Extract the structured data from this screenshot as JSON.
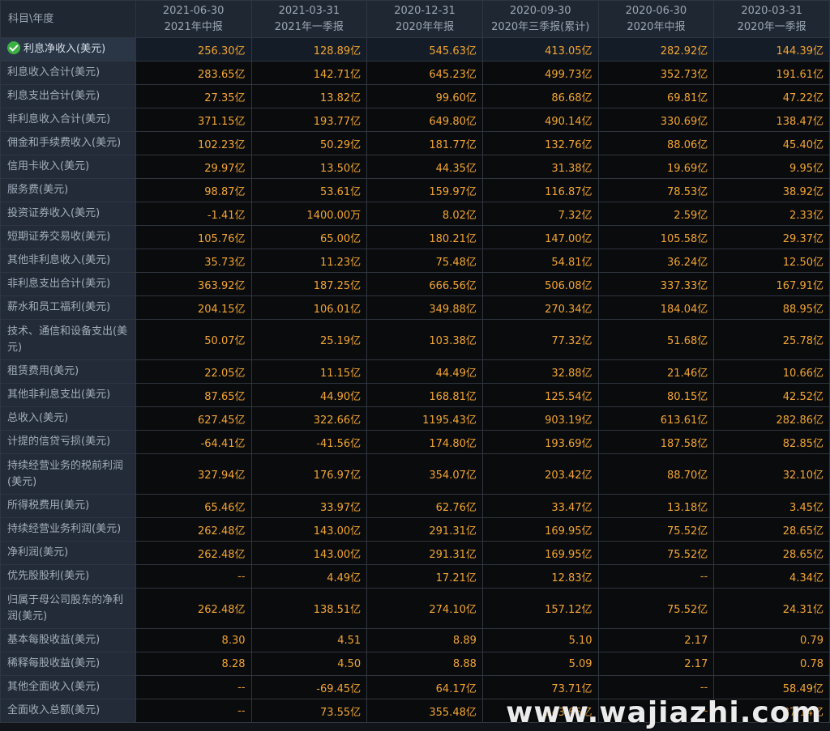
{
  "header": {
    "corner": "科目\\年度",
    "periods": [
      {
        "date": "2021-06-30",
        "label": "2021年中报"
      },
      {
        "date": "2021-03-31",
        "label": "2021年一季报"
      },
      {
        "date": "2020-12-31",
        "label": "2020年年报"
      },
      {
        "date": "2020-09-30",
        "label": "2020年三季报(累计)"
      },
      {
        "date": "2020-06-30",
        "label": "2020年中报"
      },
      {
        "date": "2020-03-31",
        "label": "2020年一季报"
      }
    ]
  },
  "rows": [
    {
      "label": "利息净收入(美元)",
      "values": [
        "256.30亿",
        "128.89亿",
        "545.63亿",
        "413.05亿",
        "282.92亿",
        "144.39亿"
      ]
    },
    {
      "label": "利息收入合计(美元)",
      "values": [
        "283.65亿",
        "142.71亿",
        "645.23亿",
        "499.73亿",
        "352.73亿",
        "191.61亿"
      ]
    },
    {
      "label": "利息支出合计(美元)",
      "values": [
        "27.35亿",
        "13.82亿",
        "99.60亿",
        "86.68亿",
        "69.81亿",
        "47.22亿"
      ]
    },
    {
      "label": "非利息收入合计(美元)",
      "values": [
        "371.15亿",
        "193.77亿",
        "649.80亿",
        "490.14亿",
        "330.69亿",
        "138.47亿"
      ]
    },
    {
      "label": "佣金和手续费收入(美元)",
      "values": [
        "102.23亿",
        "50.29亿",
        "181.77亿",
        "132.76亿",
        "88.06亿",
        "45.40亿"
      ]
    },
    {
      "label": "信用卡收入(美元)",
      "values": [
        "29.97亿",
        "13.50亿",
        "44.35亿",
        "31.38亿",
        "19.69亿",
        "9.95亿"
      ]
    },
    {
      "label": "服务费(美元)",
      "values": [
        "98.87亿",
        "53.61亿",
        "159.97亿",
        "116.87亿",
        "78.53亿",
        "38.92亿"
      ]
    },
    {
      "label": "投资证券收入(美元)",
      "values": [
        "-1.41亿",
        "1400.00万",
        "8.02亿",
        "7.32亿",
        "2.59亿",
        "2.33亿"
      ]
    },
    {
      "label": "短期证券交易收(美元)",
      "values": [
        "105.76亿",
        "65.00亿",
        "180.21亿",
        "147.00亿",
        "105.58亿",
        "29.37亿"
      ]
    },
    {
      "label": "其他非利息收入(美元)",
      "values": [
        "35.73亿",
        "11.23亿",
        "75.48亿",
        "54.81亿",
        "36.24亿",
        "12.50亿"
      ]
    },
    {
      "label": "非利息支出合计(美元)",
      "values": [
        "363.92亿",
        "187.25亿",
        "666.56亿",
        "506.08亿",
        "337.33亿",
        "167.91亿"
      ]
    },
    {
      "label": "薪水和员工福利(美元)",
      "values": [
        "204.15亿",
        "106.01亿",
        "349.88亿",
        "270.34亿",
        "184.04亿",
        "88.95亿"
      ]
    },
    {
      "label": "技术、通信和设备支出(美元)",
      "values": [
        "50.07亿",
        "25.19亿",
        "103.38亿",
        "77.32亿",
        "51.68亿",
        "25.78亿"
      ]
    },
    {
      "label": "租赁费用(美元)",
      "values": [
        "22.05亿",
        "11.15亿",
        "44.49亿",
        "32.88亿",
        "21.46亿",
        "10.66亿"
      ]
    },
    {
      "label": "其他非利息支出(美元)",
      "values": [
        "87.65亿",
        "44.90亿",
        "168.81亿",
        "125.54亿",
        "80.15亿",
        "42.52亿"
      ]
    },
    {
      "label": "总收入(美元)",
      "values": [
        "627.45亿",
        "322.66亿",
        "1195.43亿",
        "903.19亿",
        "613.61亿",
        "282.86亿"
      ]
    },
    {
      "label": "计提的信贷亏损(美元)",
      "values": [
        "-64.41亿",
        "-41.56亿",
        "174.80亿",
        "193.69亿",
        "187.58亿",
        "82.85亿"
      ]
    },
    {
      "label": "持续经营业务的税前利润(美元)",
      "values": [
        "327.94亿",
        "176.97亿",
        "354.07亿",
        "203.42亿",
        "88.70亿",
        "32.10亿"
      ]
    },
    {
      "label": "所得税费用(美元)",
      "values": [
        "65.46亿",
        "33.97亿",
        "62.76亿",
        "33.47亿",
        "13.18亿",
        "3.45亿"
      ]
    },
    {
      "label": "持续经营业务利润(美元)",
      "values": [
        "262.48亿",
        "143.00亿",
        "291.31亿",
        "169.95亿",
        "75.52亿",
        "28.65亿"
      ]
    },
    {
      "label": "净利润(美元)",
      "values": [
        "262.48亿",
        "143.00亿",
        "291.31亿",
        "169.95亿",
        "75.52亿",
        "28.65亿"
      ]
    },
    {
      "label": "优先股股利(美元)",
      "values": [
        "--",
        "4.49亿",
        "17.21亿",
        "12.83亿",
        "--",
        "4.34亿"
      ]
    },
    {
      "label": "归属于母公司股东的净利润(美元)",
      "values": [
        "262.48亿",
        "138.51亿",
        "274.10亿",
        "157.12亿",
        "75.52亿",
        "24.31亿"
      ]
    },
    {
      "label": "基本每股收益(美元)",
      "values": [
        "8.30",
        "4.51",
        "8.89",
        "5.10",
        "2.17",
        "0.79"
      ]
    },
    {
      "label": "稀释每股收益(美元)",
      "values": [
        "8.28",
        "4.50",
        "8.88",
        "5.09",
        "2.17",
        "0.78"
      ]
    },
    {
      "label": "其他全面收入(美元)",
      "values": [
        "--",
        "-69.45亿",
        "64.17亿",
        "73.71亿",
        "--",
        "58.49亿"
      ]
    },
    {
      "label": "全面收入总额(美元)",
      "values": [
        "--",
        "73.55亿",
        "355.48亿",
        "243.66亿",
        "--",
        "87.14亿"
      ]
    }
  ],
  "watermark": "www.wajiazhi.com",
  "colors": {
    "value_text": "#f2a531",
    "label_bg": "#222b37",
    "value_bg": "#0a0b0d",
    "check": "#3cb043"
  }
}
